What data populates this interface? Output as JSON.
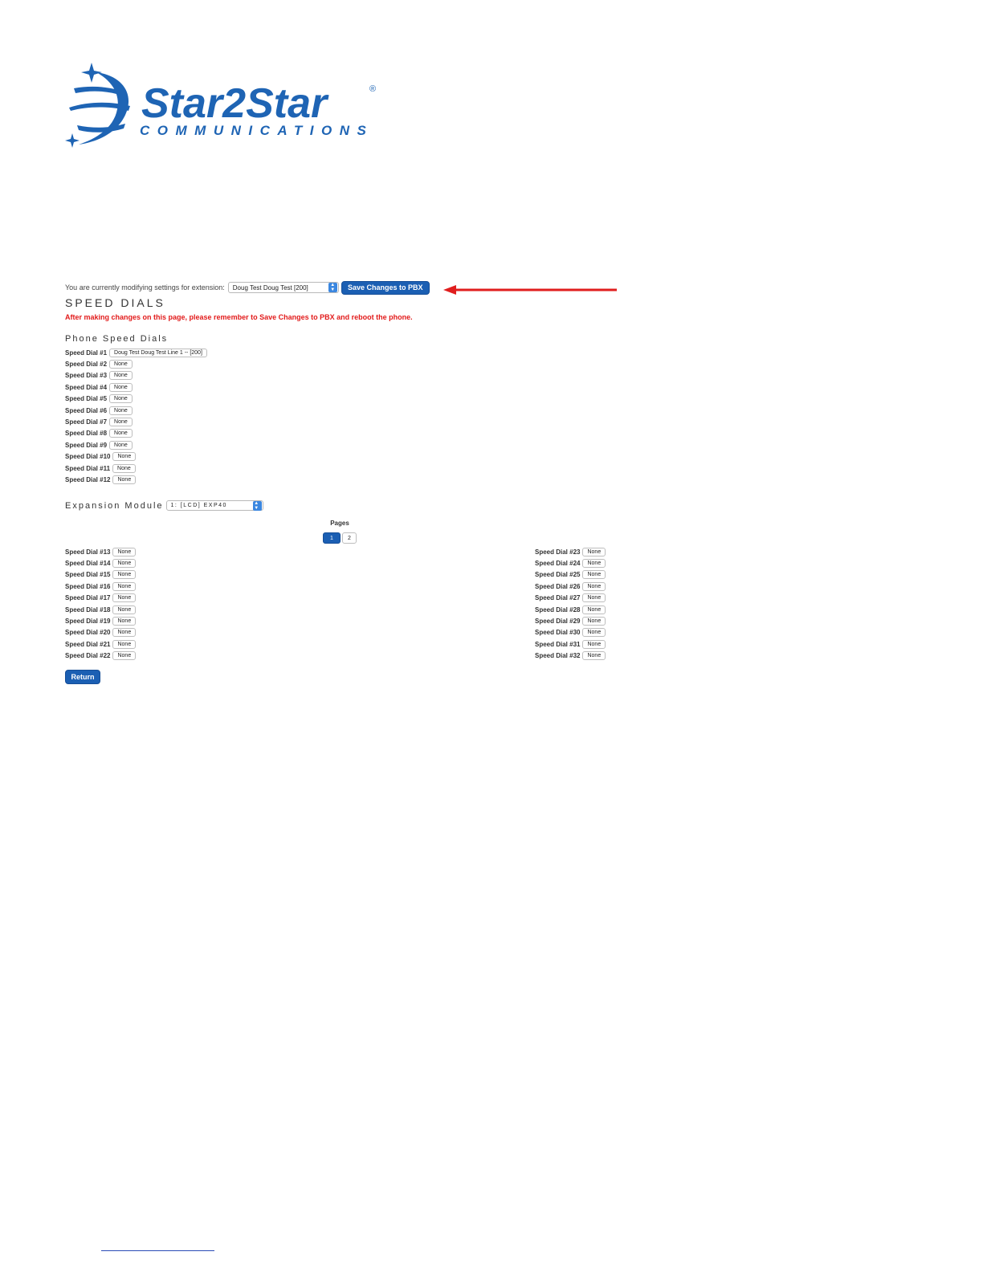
{
  "brand": {
    "name": "Star2Star",
    "tagline": "COMMUNICATIONS",
    "registered": "®",
    "color": "#1e64b4"
  },
  "extension_bar": {
    "prefix": "You are currently modifying settings for extension:",
    "selected_extension": "Doug Test Doug Test [200]",
    "save_label": "Save Changes to PBX"
  },
  "annotation": {
    "arrow_color": "#e01e1e"
  },
  "page": {
    "title": "SPEED DIALS",
    "warning": "After making changes on this page, please remember to Save Changes to PBX and reboot the phone."
  },
  "phone_speed_dials": {
    "title": "Phone Speed Dials",
    "items": [
      {
        "label": "Speed Dial #1",
        "value": "Doug Test Doug Test Line 1 -- [200]"
      },
      {
        "label": "Speed Dial #2",
        "value": "None"
      },
      {
        "label": "Speed Dial #3",
        "value": "None"
      },
      {
        "label": "Speed Dial #4",
        "value": "None"
      },
      {
        "label": "Speed Dial #5",
        "value": "None"
      },
      {
        "label": "Speed Dial #6",
        "value": "None"
      },
      {
        "label": "Speed Dial #7",
        "value": "None"
      },
      {
        "label": "Speed Dial #8",
        "value": "None"
      },
      {
        "label": "Speed Dial #9",
        "value": "None"
      },
      {
        "label": "Speed Dial #10",
        "value": "None"
      },
      {
        "label": "Speed Dial #11",
        "value": "None"
      },
      {
        "label": "Speed Dial #12",
        "value": "None"
      }
    ]
  },
  "expansion_module": {
    "label": "Expansion Module",
    "selected": "1: [LCD] EXP40",
    "pages_label": "Pages",
    "pages": [
      "1",
      "2"
    ],
    "active_page": "1",
    "left_column": [
      {
        "label": "Speed Dial #13",
        "value": "None"
      },
      {
        "label": "Speed Dial #14",
        "value": "None"
      },
      {
        "label": "Speed Dial #15",
        "value": "None"
      },
      {
        "label": "Speed Dial #16",
        "value": "None"
      },
      {
        "label": "Speed Dial #17",
        "value": "None"
      },
      {
        "label": "Speed Dial #18",
        "value": "None"
      },
      {
        "label": "Speed Dial #19",
        "value": "None"
      },
      {
        "label": "Speed Dial #20",
        "value": "None"
      },
      {
        "label": "Speed Dial #21",
        "value": "None"
      },
      {
        "label": "Speed Dial #22",
        "value": "None"
      }
    ],
    "right_column": [
      {
        "label": "Speed Dial #23",
        "value": "None"
      },
      {
        "label": "Speed Dial #24",
        "value": "None"
      },
      {
        "label": "Speed Dial #25",
        "value": "None"
      },
      {
        "label": "Speed Dial #26",
        "value": "None"
      },
      {
        "label": "Speed Dial #27",
        "value": "None"
      },
      {
        "label": "Speed Dial #28",
        "value": "None"
      },
      {
        "label": "Speed Dial #29",
        "value": "None"
      },
      {
        "label": "Speed Dial #30",
        "value": "None"
      },
      {
        "label": "Speed Dial #31",
        "value": "None"
      },
      {
        "label": "Speed Dial #32",
        "value": "None"
      }
    ]
  },
  "actions": {
    "return_label": "Return"
  }
}
